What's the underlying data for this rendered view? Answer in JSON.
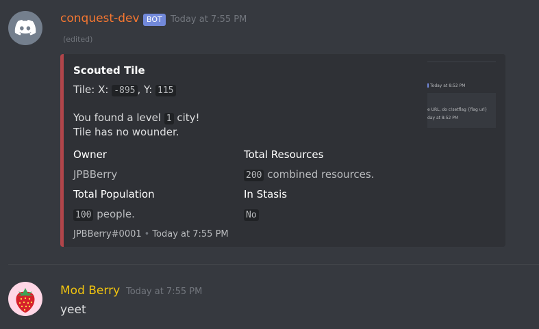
{
  "msg1": {
    "username": "conquest-dev",
    "username_color": "#f57731",
    "badge": "BOT",
    "timestamp": "Today at 7:55 PM",
    "edited": "(edited)",
    "avatar_icon": "discord-logo-icon"
  },
  "embed": {
    "accent": "#b1454a",
    "title": "Scouted Tile",
    "tile_prefix": "Tile: X: ",
    "tile_x": "-895",
    "tile_mid": ", Y: ",
    "tile_y": "115",
    "found_prefix": "You found a level ",
    "found_level": "1",
    "found_suffix": " city!",
    "wonder_line": "Tile has no wounder.",
    "fields": {
      "owner_name": "Owner",
      "owner_value": "JPBBerry",
      "resources_name": "Total Resources",
      "resources_value_code": "200",
      "resources_value_text": " combined resources.",
      "population_name": "Total Population",
      "population_value_code": "100",
      "population_value_text": " people.",
      "stasis_name": "In Stasis",
      "stasis_value_code": "No"
    },
    "footer_author": "JPBBerry#0001",
    "footer_sep": "•",
    "footer_time": "Today at 7:55 PM",
    "thumbnail": {
      "line1": "Today at 8:52 PM",
      "line2": "e URL, do c!setflag {flag url}",
      "line3": "day at 8:52 PM"
    }
  },
  "msg2": {
    "username": "Mod Berry",
    "username_color": "#f1c40f",
    "timestamp": "Today at 7:55 PM",
    "text": "yeet",
    "avatar_icon": "strawberry-icon"
  }
}
